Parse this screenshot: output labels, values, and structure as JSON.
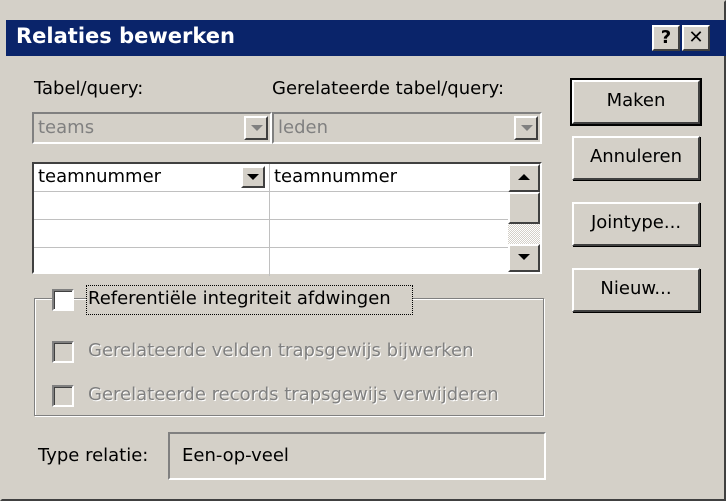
{
  "window": {
    "title": "Relaties bewerken",
    "help_label": "?",
    "close_label": "✕"
  },
  "table": {
    "label": "Tabel/query:",
    "value": "teams"
  },
  "related_table": {
    "label": "Gerelateerde tabel/query:",
    "value": "leden"
  },
  "fields_grid": {
    "rows": [
      {
        "left": "teamnummer",
        "right": "teamnummer"
      },
      {
        "left": "",
        "right": ""
      },
      {
        "left": "",
        "right": ""
      },
      {
        "left": "",
        "right": ""
      }
    ]
  },
  "options": {
    "referential_integrity": {
      "label": "Referentiële integriteit afdwingen",
      "checked": false
    },
    "cascade_update": {
      "label": "Gerelateerde velden trapsgewijs bijwerken",
      "checked": false,
      "enabled": false
    },
    "cascade_delete": {
      "label": "Gerelateerde records trapsgewijs verwijderen",
      "checked": false,
      "enabled": false
    }
  },
  "relation_type": {
    "label": "Type relatie:",
    "value": "Een-op-veel"
  },
  "buttons": {
    "create": "Maken",
    "cancel": "Annuleren",
    "join_type": "Jointype...",
    "new": "Nieuw..."
  },
  "colors": {
    "titlebar": "#0a246a",
    "face": "#d4d0c8",
    "disabled_text": "#808080"
  }
}
